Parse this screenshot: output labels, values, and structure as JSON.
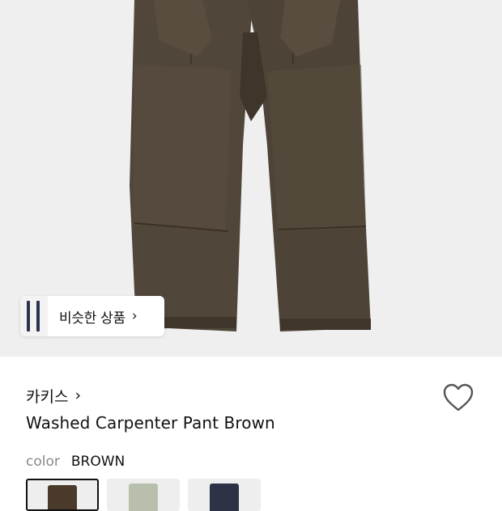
{
  "similar_products": {
    "label": "비슷한 상품",
    "arrow": "›"
  },
  "product": {
    "brand": "카키스",
    "brand_chevron": "›",
    "title": "Washed Carpenter Pant Brown",
    "color_label": "color",
    "color_value": "BROWN"
  },
  "icons": {
    "heart": "heart-outline-icon",
    "chevron": "chevron-right-icon"
  },
  "swatches": [
    {
      "name": "brown",
      "color": "#4a3a2c",
      "selected": true
    },
    {
      "name": "sage",
      "color": "#b8c0ad",
      "selected": false
    },
    {
      "name": "navy",
      "color": "#2c3346",
      "selected": false
    }
  ],
  "colors": {
    "pant_main": "#4f4436",
    "pant_shade": "#3e3429",
    "hero_bg": "#efefef"
  }
}
